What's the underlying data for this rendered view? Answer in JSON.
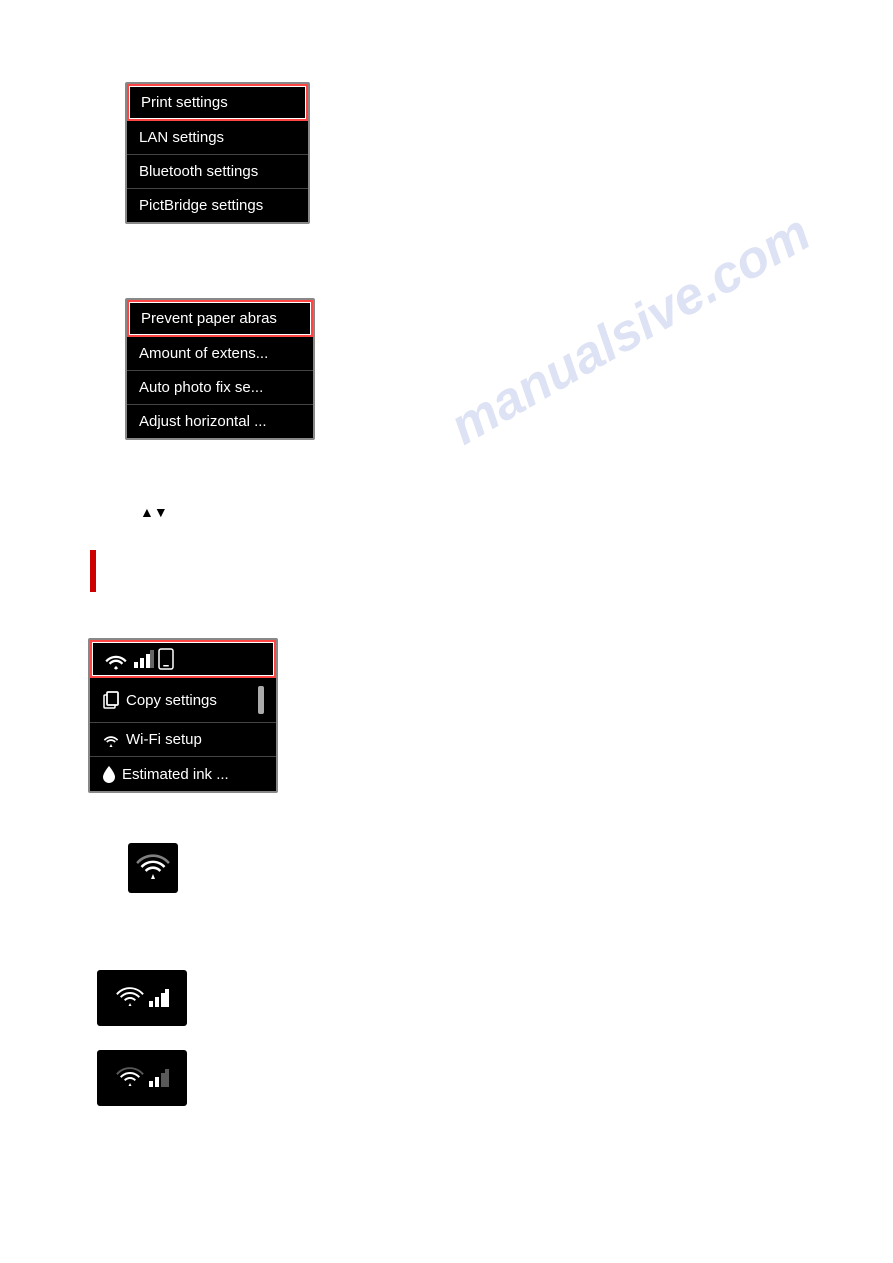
{
  "watermark": "manualsive.com",
  "panel1": {
    "items": [
      {
        "label": "Print settings",
        "selected": true
      },
      {
        "label": "LAN settings",
        "selected": false
      },
      {
        "label": "Bluetooth settings",
        "selected": false
      },
      {
        "label": "PictBridge settings",
        "selected": false
      }
    ]
  },
  "panel2": {
    "items": [
      {
        "label": "Prevent paper abras",
        "selected": true
      },
      {
        "label": "Amount of extens...",
        "selected": false
      },
      {
        "label": "Auto photo fix se...",
        "selected": false
      },
      {
        "label": "Adjust horizontal ...",
        "selected": false
      }
    ]
  },
  "arrows": "▲▼",
  "panel3": {
    "menu_items": [
      {
        "label": "Copy settings",
        "has_icon": true,
        "icon_type": "copy",
        "has_scroll": true
      },
      {
        "label": "Wi-Fi setup",
        "has_icon": true,
        "icon_type": "wifi"
      },
      {
        "label": "Estimated ink ...",
        "has_icon": true,
        "icon_type": "drop"
      }
    ]
  },
  "icons": {
    "wifi_label": "WiFi icon",
    "signal_full_label": "WiFi signal full",
    "signal_low_label": "WiFi signal low"
  }
}
